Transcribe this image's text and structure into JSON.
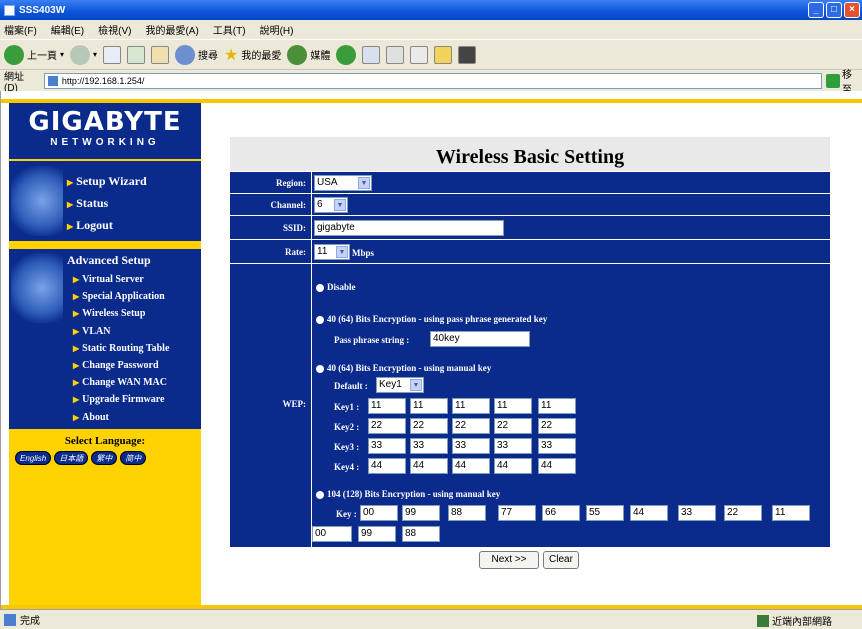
{
  "window": {
    "title": "SSS403W",
    "min": "_",
    "max": "□",
    "close": "×"
  },
  "menu": [
    "檔案(F)",
    "編輯(E)",
    "檢視(V)",
    "我的最愛(A)",
    "工具(T)",
    "說明(H)"
  ],
  "toolbar": {
    "back": "上一頁",
    "search": "搜尋",
    "favorites": "我的最愛",
    "media": "媒體"
  },
  "address": {
    "label": "網址(D)",
    "url": "http://192.168.1.254/",
    "go": "移至"
  },
  "logo": {
    "line1": "GIGABYTE",
    "line2": "NETWORKING"
  },
  "nav_main": [
    "Setup Wizard",
    "Status",
    "Logout"
  ],
  "nav_advanced": {
    "heading": "Advanced Setup",
    "items": [
      "Virtual Server",
      "Special Application",
      "Wireless Setup",
      "VLAN",
      "Static Routing Table",
      "Change Password",
      "Change WAN MAC",
      "Upgrade Firmware",
      "About"
    ]
  },
  "language": {
    "label": "Select Language:",
    "options": [
      "English",
      "日本語",
      "繁中",
      "简中"
    ]
  },
  "page_title": "Wireless Basic Setting",
  "form": {
    "region_label": "Region:",
    "region_value": "USA",
    "channel_label": "Channel:",
    "channel_value": "6",
    "ssid_label": "SSID:",
    "ssid_value": "gigabyte",
    "rate_label": "Rate:",
    "rate_value": "11",
    "rate_unit": "Mbps",
    "wep_label": "WEP:",
    "opt_disable": "Disable",
    "opt_passphrase": "40 (64) Bits Encryption - using pass phrase generated key",
    "passphrase_label": "Pass phrase string :",
    "passphrase_value": "40key",
    "opt_manual40": "40 (64) Bits Encryption - using manual key",
    "default_label": "Default :",
    "default_value": "Key1",
    "keys": [
      {
        "label": "Key1 :",
        "values": [
          "11",
          "11",
          "11",
          "11",
          "11"
        ]
      },
      {
        "label": "Key2 :",
        "values": [
          "22",
          "22",
          "22",
          "22",
          "22"
        ]
      },
      {
        "label": "Key3 :",
        "values": [
          "33",
          "33",
          "33",
          "33",
          "33"
        ]
      },
      {
        "label": "Key4 :",
        "values": [
          "44",
          "44",
          "44",
          "44",
          "44"
        ]
      }
    ],
    "opt_manual104": "104 (128) Bits Encryption - using manual key",
    "key104_label": "Key :",
    "key104_row1": [
      "00",
      "99",
      "88",
      "77",
      "66",
      "55",
      "44",
      "33",
      "22",
      "11"
    ],
    "key104_row2": [
      "00",
      "99",
      "88"
    ]
  },
  "buttons": {
    "next": "Next >>",
    "clear": "Clear"
  },
  "status": {
    "left": "完成",
    "zone": "近端內部網路"
  }
}
